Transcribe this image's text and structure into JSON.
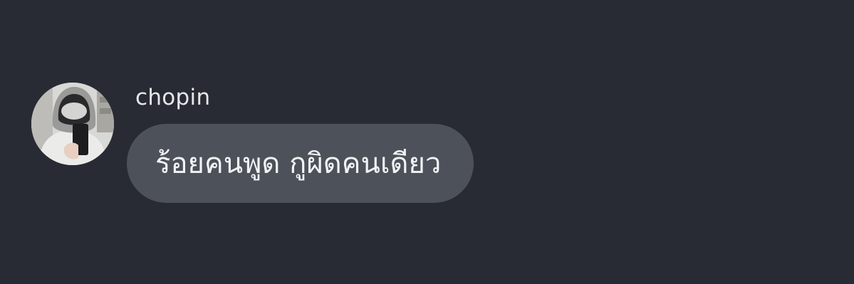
{
  "message": {
    "sender": "chopin",
    "text": "ร้อยคนพูด กูผิดคนเดียว"
  },
  "colors": {
    "background": "#282b33",
    "bubble": "#4d5159",
    "text": "#f2f3f5",
    "name": "#e6e7ea"
  }
}
